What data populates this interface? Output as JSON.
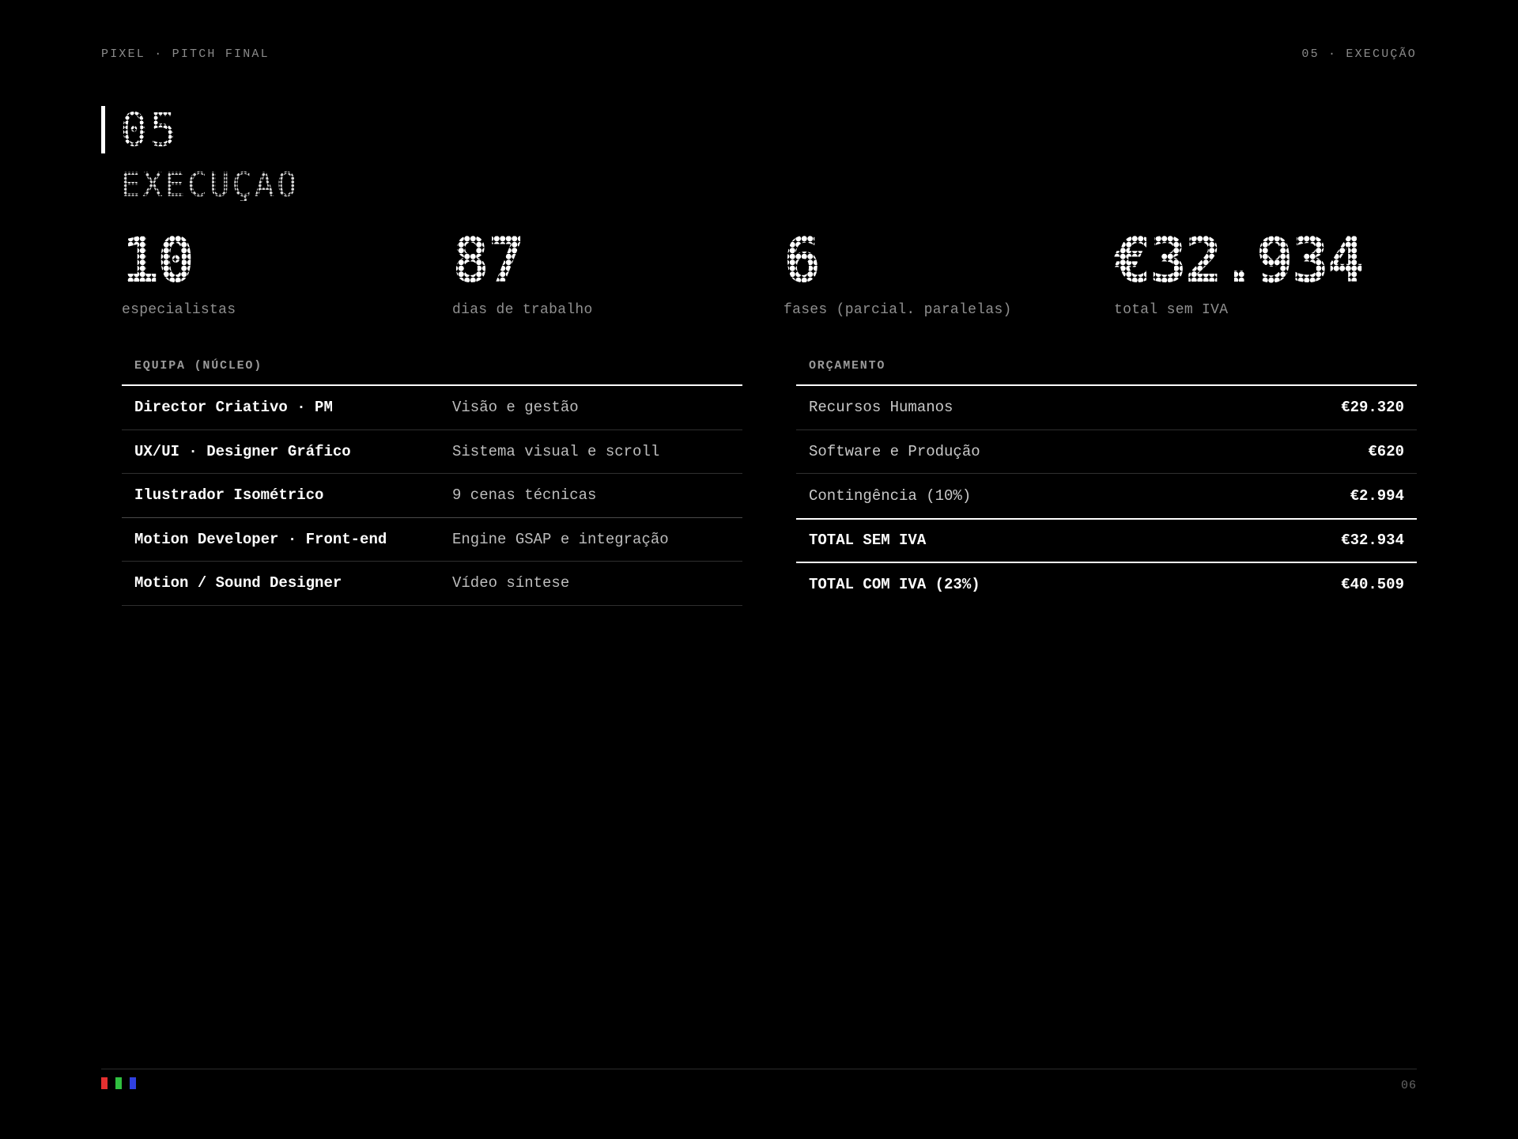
{
  "header": {
    "left": "PIXEL · PITCH FINAL",
    "right": "05 · EXECUÇÃO"
  },
  "section": {
    "number": "05",
    "title": "EXECUÇÃO"
  },
  "stats": [
    {
      "value": "10",
      "label": "especialistas"
    },
    {
      "value": "87",
      "label": "dias de trabalho"
    },
    {
      "value": "6",
      "label": "fases (parcial. paralelas)"
    },
    {
      "value": "€32.934",
      "label": "total sem IVA"
    }
  ],
  "team": {
    "heading": "EQUIPA (NÚCLEO)",
    "rows": [
      {
        "role": "Director Criativo · PM",
        "desc": "Visão e gestão"
      },
      {
        "role": "UX/UI · Designer Gráfico",
        "desc": "Sistema visual e scroll"
      },
      {
        "role": "Ilustrador Isométrico",
        "desc": "9 cenas técnicas"
      },
      {
        "role": "Motion Developer · Front-end",
        "desc": "Engine GSAP e integração"
      },
      {
        "role": "Motion / Sound Designer",
        "desc": "Vídeo síntese"
      }
    ]
  },
  "budget": {
    "heading": "ORÇAMENTO",
    "rows": [
      {
        "item": "Recursos Humanos",
        "amount": "€29.320"
      },
      {
        "item": "Software e Produção",
        "amount": "€620"
      },
      {
        "item": "Contingência (10%)",
        "amount": "€2.994"
      },
      {
        "item": "TOTAL SEM IVA",
        "amount": "€32.934"
      },
      {
        "item": "TOTAL COM IVA (23%)",
        "amount": "€40.509"
      }
    ]
  },
  "footer": {
    "page_number": "06",
    "swatch_colors": [
      "#e53030",
      "#30c040",
      "#3040e0"
    ]
  }
}
